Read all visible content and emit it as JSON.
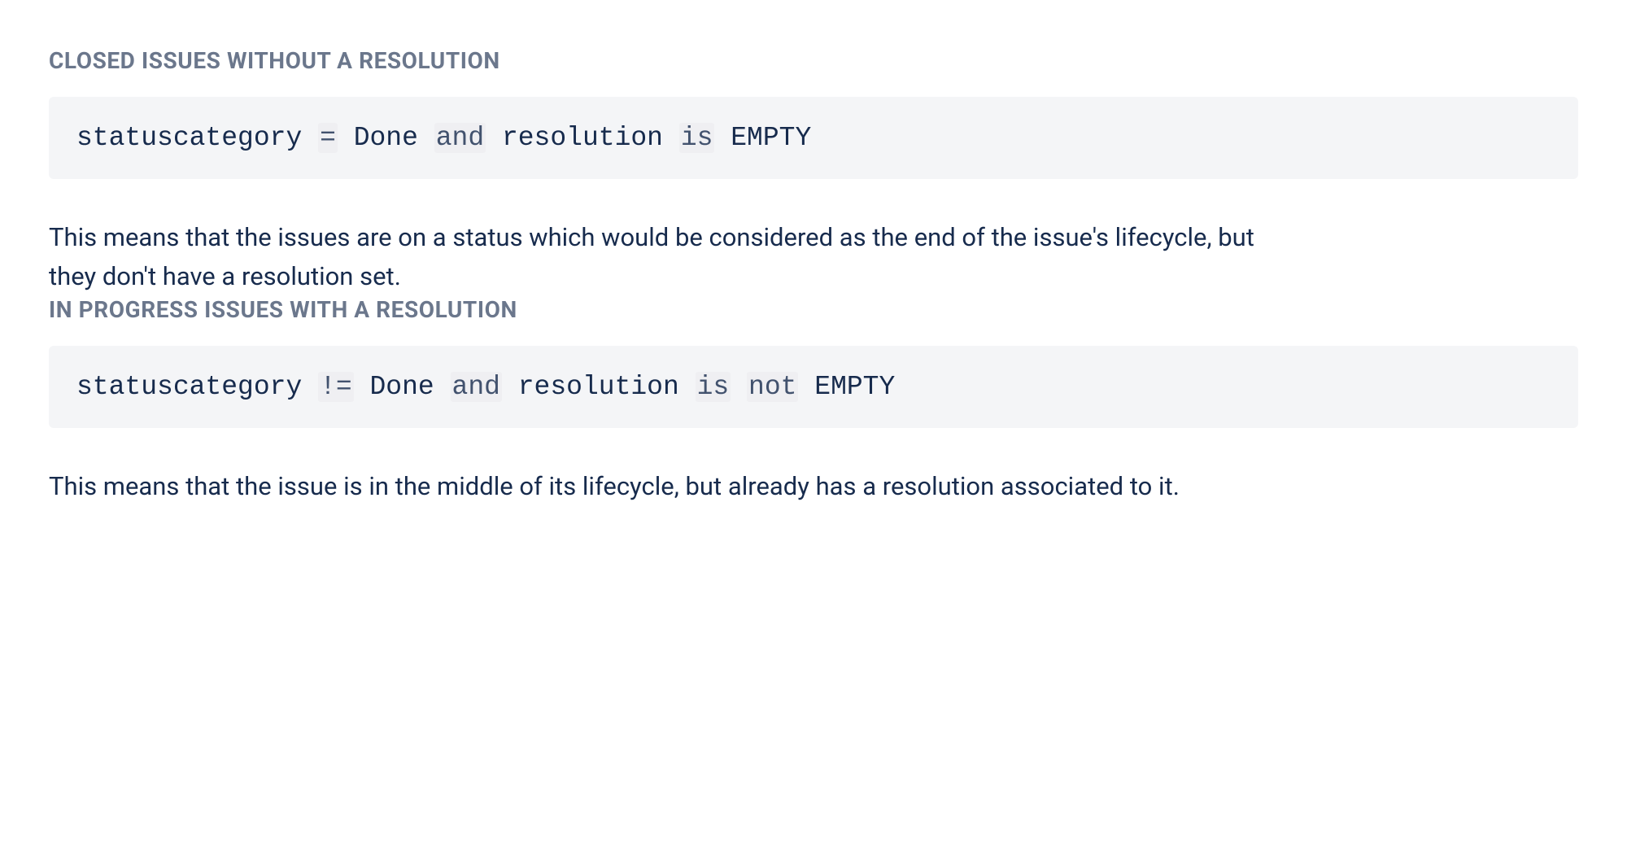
{
  "sections": [
    {
      "heading": "CLOSED ISSUES WITHOUT A RESOLUTION",
      "code_parts": {
        "field1": "statuscategory",
        "op": "=",
        "value1": "Done",
        "kw_and": "and",
        "field2": "resolution",
        "kw_is": "is",
        "value2": "EMPTY"
      },
      "description": "This means that the issues are on a status which would be considered as the end of the issue's lifecycle, but they don't have a resolution set."
    },
    {
      "heading": "IN PROGRESS ISSUES WITH A RESOLUTION",
      "code_parts": {
        "field1": "statuscategory",
        "op": "!=",
        "value1": "Done",
        "kw_and": "and",
        "field2": "resolution",
        "kw_is": "is",
        "kw_not": "not",
        "value2": "EMPTY"
      },
      "description": "This means that the issue is in the middle of its lifecycle, but already has a resolution associated to it."
    }
  ]
}
